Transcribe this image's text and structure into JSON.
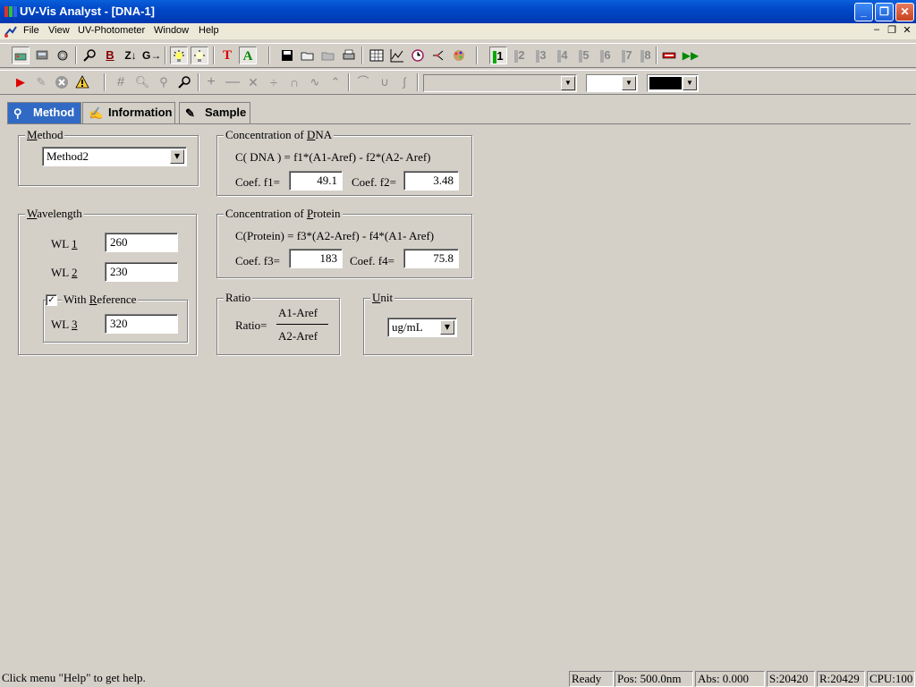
{
  "window": {
    "title": "UV-Vis Analyst - [DNA-1]",
    "minimize": "_",
    "maximize": "❐",
    "close": "✕"
  },
  "menu": {
    "items": [
      "File",
      "View",
      "UV-Photometer",
      "Window",
      "Help"
    ],
    "mdi_minimize": "–",
    "mdi_restore": "❐",
    "mdi_close": "✕"
  },
  "toolbar1": {
    "icons": [
      "connect-icon",
      "instrument-icon",
      "settings-icon",
      "search-icon",
      "bold-icon",
      "sort-icon",
      "gauge-icon",
      "lamp-on-icon",
      "lamp-off-icon",
      "text-red-icon",
      "text-green-icon",
      "save-icon",
      "open-icon",
      "folder-icon",
      "print-icon",
      "table-icon",
      "chart-icon",
      "clock-icon",
      "branch-icon",
      "palette-icon",
      "cell-icon",
      "fast-forward-icon"
    ],
    "text_glyphs": {
      "bold": "B",
      "text_red": "T",
      "text_green": "A"
    },
    "cells": [
      "1",
      "2",
      "3",
      "4",
      "5",
      "6",
      "7",
      "8"
    ]
  },
  "toolbar2": {
    "icons": [
      "run-icon",
      "wand-icon",
      "stop-icon",
      "warning-icon",
      "grid-icon",
      "zoom-in-icon",
      "zoom-out-icon",
      "zoom-fit-icon",
      "add-icon",
      "subtract-icon",
      "multiply-icon",
      "divide-icon",
      "peak-icon",
      "smooth-icon",
      "derivative-icon",
      "curve-icon",
      "valley-icon",
      "integral-icon"
    ],
    "combo1_value": "",
    "combo2_value": "",
    "color_value": "#000000"
  },
  "tabs": [
    {
      "label": "Method",
      "icon": "search-icon",
      "active": true
    },
    {
      "label": "Information",
      "icon": "info-icon",
      "active": false
    },
    {
      "label": "Sample",
      "icon": "sample-icon",
      "active": false
    }
  ],
  "method_group": {
    "legend": "Method",
    "value": "Method2"
  },
  "wavelength_group": {
    "legend": "Wavelength",
    "wl1_label": "WL 1",
    "wl1_value": "260",
    "wl2_label": "WL 2",
    "wl2_value": "230",
    "reference_label": "With Reference",
    "reference_checked": true,
    "check_mark": "✓",
    "wl3_label": "WL 3",
    "wl3_value": "320"
  },
  "dna_group": {
    "legend": "Concentration of DNA",
    "formula": "C( DNA ) = f1*(A1-Aref) - f2*(A2- Aref)",
    "f1_label": "Coef. f1=",
    "f1_value": "49.1",
    "f2_label": "Coef. f2=",
    "f2_value": "3.48"
  },
  "protein_group": {
    "legend": "Concentration of Protein",
    "formula": "C(Protein) = f3*(A2-Aref) - f4*(A1- Aref)",
    "f3_label": "Coef. f3=",
    "f3_value": "183",
    "f4_label": "Coef. f4=",
    "f4_value": "75.8"
  },
  "ratio_group": {
    "legend": "Ratio",
    "label": "Ratio=",
    "numerator": "A1-Aref",
    "denominator": "A2-Aref"
  },
  "unit_group": {
    "legend": "Unit",
    "value": "ug/mL"
  },
  "statusbar": {
    "help": "Click menu \"Help\" to get help.",
    "state": "Ready",
    "pos": "Pos: 500.0nm",
    "abs": "Abs: 0.000",
    "s": "S:20420",
    "r": "R:20429",
    "cpu": "CPU:100"
  },
  "colors": {
    "title_bar": "#0048c8",
    "active_tab": "#316ac5",
    "face": "#d4d0c8"
  }
}
